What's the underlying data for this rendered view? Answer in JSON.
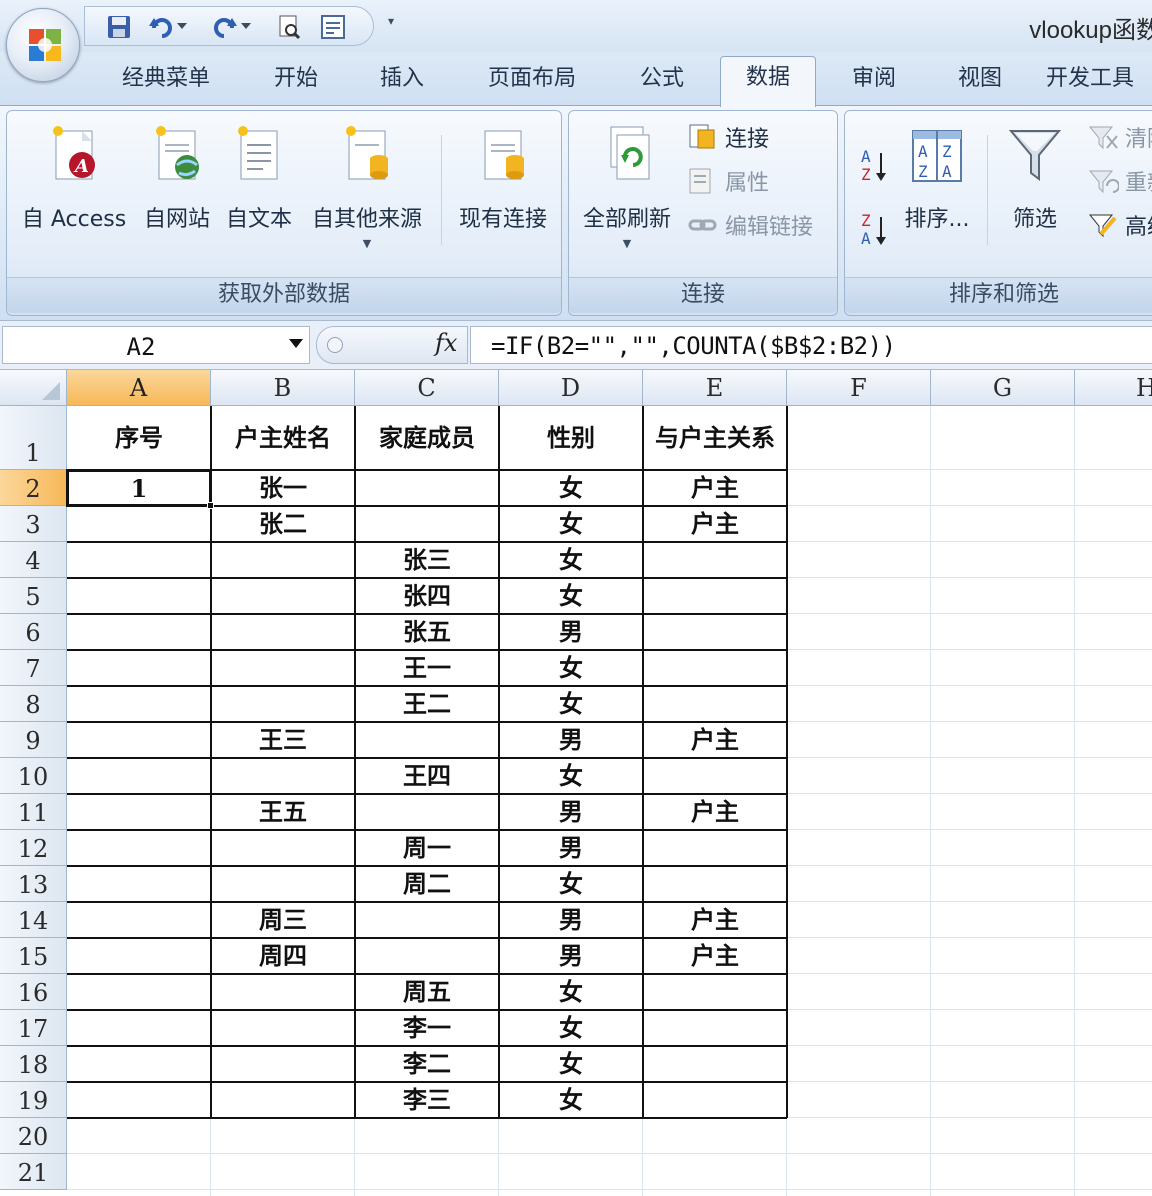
{
  "window": {
    "title": "vlookup函数",
    "qat": [
      "save-icon",
      "undo-icon",
      "redo-icon",
      "print-preview-icon",
      "form-icon"
    ]
  },
  "ribbon": {
    "tabs": [
      {
        "label": "经典菜单"
      },
      {
        "label": "开始"
      },
      {
        "label": "插入"
      },
      {
        "label": "页面布局"
      },
      {
        "label": "公式"
      },
      {
        "label": "数据",
        "active": true
      },
      {
        "label": "审阅"
      },
      {
        "label": "视图"
      },
      {
        "label": "开发工具"
      }
    ],
    "groups": {
      "external": {
        "label": "获取外部数据",
        "buttons": [
          "自 Access",
          "自网站",
          "自文本",
          "自其他来源",
          "现有连接"
        ]
      },
      "connections": {
        "label": "连接",
        "refresh_all": "全部刷新",
        "connections": "连接",
        "properties": "属性",
        "edit_links": "编辑链接"
      },
      "sort_filter": {
        "label": "排序和筛选",
        "sort": "排序...",
        "filter": "筛选",
        "clear": "清除",
        "reapply": "重新应用",
        "advanced": "高级"
      }
    }
  },
  "formula_bar": {
    "name_box": "A2",
    "formula": "=IF(B2=\"\",\"\",COUNTA($B$2:B2))"
  },
  "sheet": {
    "columns": [
      "A",
      "B",
      "C",
      "D",
      "E",
      "F",
      "G",
      "H"
    ],
    "rows": [
      "1",
      "2",
      "3",
      "4",
      "5",
      "6",
      "7",
      "8",
      "9",
      "10",
      "11",
      "12",
      "13",
      "14",
      "15",
      "16",
      "17",
      "18",
      "19",
      "20",
      "21"
    ],
    "selected_cell": "A2",
    "header_row": [
      "序号",
      "户主姓名",
      "家庭成员",
      "性别",
      "与户主关系"
    ],
    "data": [
      [
        "1",
        "张一",
        "",
        "女",
        "户主"
      ],
      [
        "",
        "张二",
        "",
        "女",
        "户主"
      ],
      [
        "",
        "",
        "张三",
        "女",
        ""
      ],
      [
        "",
        "",
        "张四",
        "女",
        ""
      ],
      [
        "",
        "",
        "张五",
        "男",
        ""
      ],
      [
        "",
        "",
        "王一",
        "女",
        ""
      ],
      [
        "",
        "",
        "王二",
        "女",
        ""
      ],
      [
        "",
        "王三",
        "",
        "男",
        "户主"
      ],
      [
        "",
        "",
        "王四",
        "女",
        ""
      ],
      [
        "",
        "王五",
        "",
        "男",
        "户主"
      ],
      [
        "",
        "",
        "周一",
        "男",
        ""
      ],
      [
        "",
        "",
        "周二",
        "女",
        ""
      ],
      [
        "",
        "周三",
        "",
        "男",
        "户主"
      ],
      [
        "",
        "周四",
        "",
        "男",
        "户主"
      ],
      [
        "",
        "",
        "周五",
        "女",
        ""
      ],
      [
        "",
        "",
        "李一",
        "女",
        ""
      ],
      [
        "",
        "",
        "李二",
        "女",
        ""
      ],
      [
        "",
        "",
        "李三",
        "女",
        ""
      ]
    ]
  }
}
